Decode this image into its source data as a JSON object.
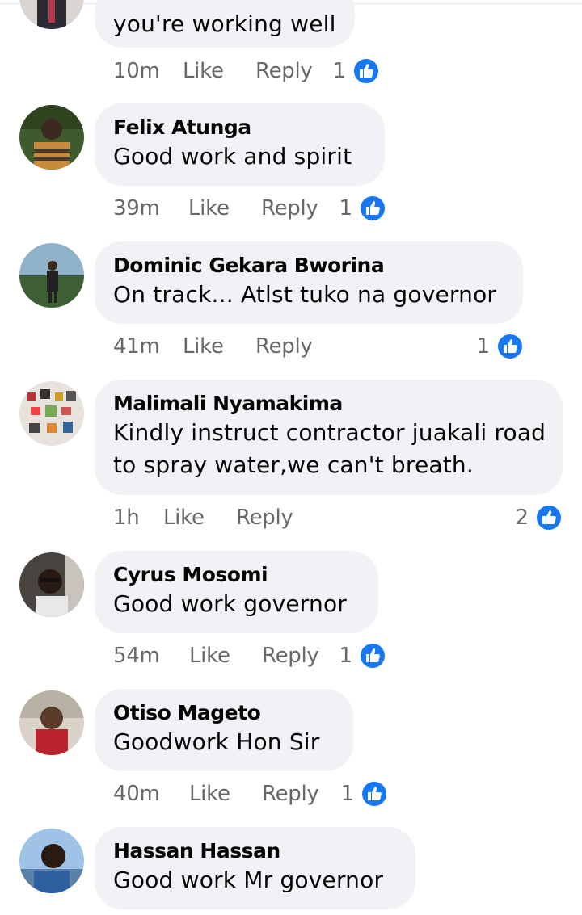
{
  "comments": [
    {
      "name": "",
      "text": "you're working well",
      "time": "10m",
      "like_label": "Like",
      "reply_label": "Reply",
      "reactions": "1"
    },
    {
      "name": "Felix Atunga",
      "text": "Good work and spirit",
      "time": "39m",
      "like_label": "Like",
      "reply_label": "Reply",
      "reactions": "1"
    },
    {
      "name": "Dominic Gekara Bworina",
      "text": "On track... Atlst tuko na governor",
      "time": "41m",
      "like_label": "Like",
      "reply_label": "Reply",
      "reactions": "1"
    },
    {
      "name": "Malimali Nyamakima",
      "text": "Kindly instruct contractor juakali road",
      "text2": "to spray water,we can't breath.",
      "time": "1h",
      "like_label": "Like",
      "reply_label": "Reply",
      "reactions": "2"
    },
    {
      "name": "Cyrus Mosomi",
      "text": "Good work governor",
      "time": "54m",
      "like_label": "Like",
      "reply_label": "Reply",
      "reactions": "1"
    },
    {
      "name": "Otiso Mageto",
      "text": "Goodwork Hon Sir",
      "time": "40m",
      "like_label": "Like",
      "reply_label": "Reply",
      "reactions": "1"
    },
    {
      "name": "Hassan Hassan",
      "text": "Good work Mr governor",
      "time": "",
      "like_label": "",
      "reply_label": "",
      "reactions": ""
    }
  ],
  "colors": {
    "bubble": "#f0f2f5",
    "meta_text": "#65676b",
    "like_blue": "#1877f2"
  },
  "icons": {
    "reaction": "thumbs-up-icon",
    "avatar": "profile-photo"
  }
}
